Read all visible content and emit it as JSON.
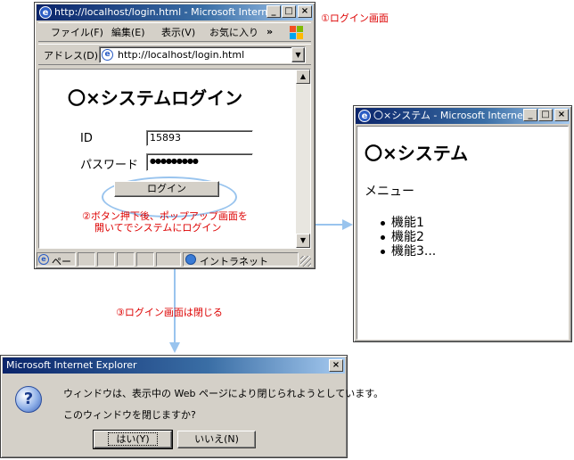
{
  "browser": {
    "title": "http://localhost/login.html - Microsoft Intern...",
    "menu": [
      "ファイル(F)",
      "編集(E)",
      "表示(V)",
      "お気に入り"
    ],
    "menu_more": "»",
    "address_label": "アドレス(D)",
    "address_value": "http://localhost/login.html",
    "status_left": "ペー",
    "status_zone": "イントラネット"
  },
  "login_page": {
    "heading": "〇×システムログイン",
    "id_label": "ID",
    "id_value": "15893",
    "password_label": "パスワード",
    "password_value": "●●●●●●●●●",
    "login_button": "ログイン"
  },
  "annotations": {
    "step1": "①ログイン画面",
    "step2_line1": "②ボタン押下後、ポップアップ画面を",
    "step2_line2": "開いてでシステムにログイン",
    "step3": "③ログイン画面は閉じる"
  },
  "popup": {
    "title": "〇×システム - Microsoft Interne...",
    "heading": "〇×システム",
    "menu_label": "メニュー",
    "items": [
      "機能1",
      "機能2",
      "機能3..."
    ]
  },
  "dialog": {
    "title": "Microsoft Internet Explorer",
    "line1": "ウィンドウは、表示中の Web ページにより閉じられようとしています。",
    "line2": "このウィンドウを閉じますか?",
    "yes_button": "はい(Y)",
    "no_button": "いいえ(N)",
    "question_glyph": "?",
    "close_glyph": "×"
  },
  "colors": {
    "annotation_red": "#dd0000",
    "arrow_blue": "#99c4ee",
    "titlebar_blue": "#0a246a"
  }
}
